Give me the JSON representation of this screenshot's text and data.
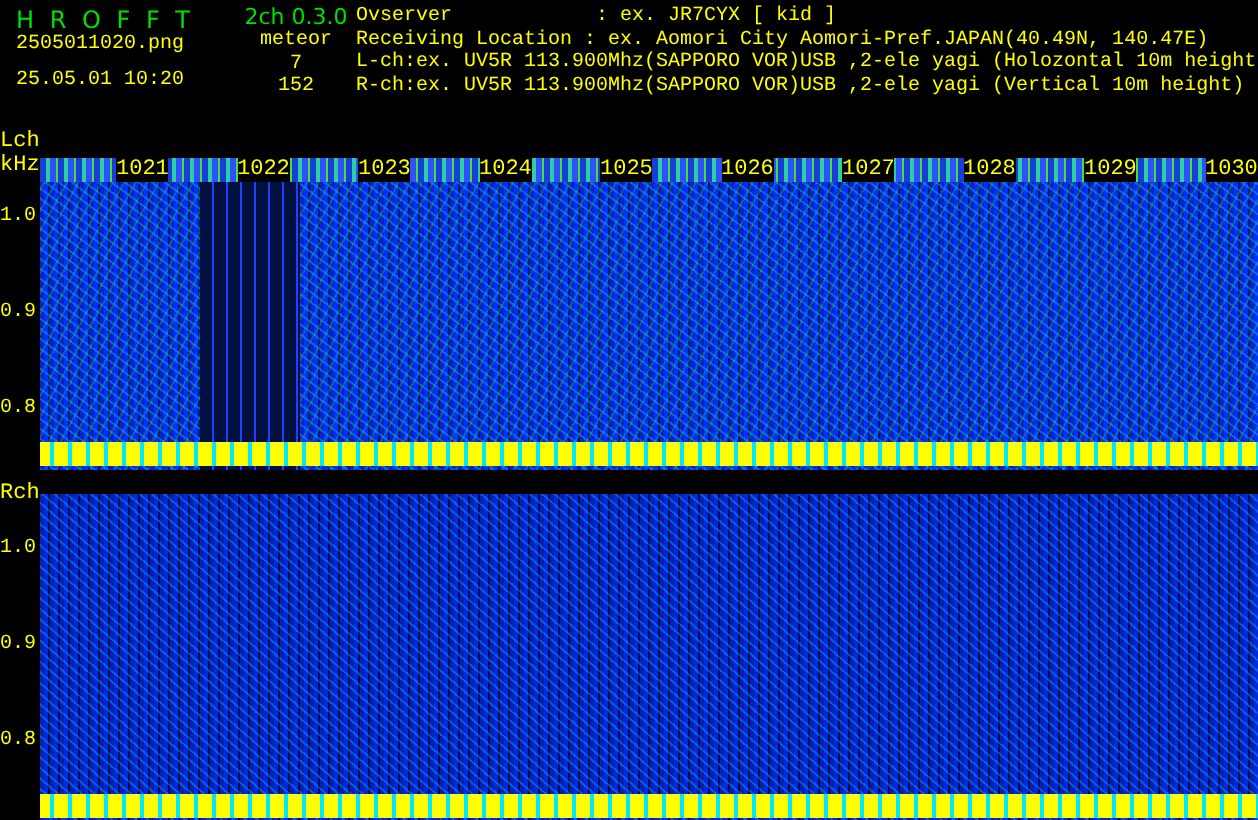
{
  "header": {
    "app_title": "H R O F F T",
    "version": "2ch 0.3.0",
    "filename": "2505011020.png",
    "datetime": "25.05.01 10:20",
    "meteor_label": "meteor",
    "meteor_counts": [
      "7",
      "152"
    ],
    "info": [
      {
        "label": "Ovserver            ",
        "value": ": ex. JR7CYX [ kid ]"
      },
      {
        "label": "Receiving Location ",
        "value": ": ex. Aomori City Aomori-Pref.JAPAN(40.49N, 140.47E)"
      },
      {
        "label": "L-ch:",
        "value": "ex. UV5R 113.900Mhz(SAPPORO VOR)USB ,2-ele yagi (Holozontal 10m height"
      },
      {
        "label": "R-ch:",
        "value": "ex. UV5R 113.900Mhz(SAPPORO VOR)USB ,2-ele yagi (Vertical 10m height)"
      }
    ]
  },
  "panels": [
    {
      "channel": "Lch",
      "unit": "kHz",
      "time_labels": [
        "1021",
        "1022",
        "1023",
        "1024",
        "1025",
        "1026",
        "1027",
        "1028",
        "1029",
        "1030"
      ],
      "y_labels": [
        "1.0",
        "0.9",
        "0.8"
      ]
    },
    {
      "channel": "Rch",
      "y_labels": [
        "1.0",
        "0.9",
        "0.8"
      ]
    }
  ]
}
